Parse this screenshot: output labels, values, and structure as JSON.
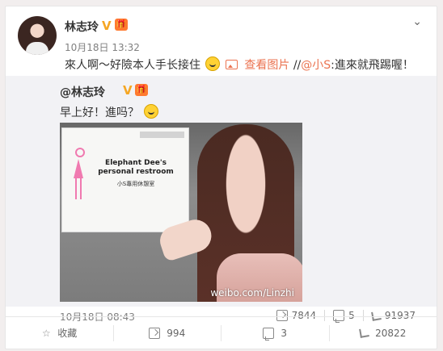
{
  "post": {
    "username": "林志玲",
    "v_badge": "V",
    "badge_icon": "🎁",
    "timestamp": "10月18日 13:32",
    "text_before": "來人啊～好險本人手长接住",
    "view_image_label": "查看图片",
    "separator": " //",
    "mention": "@小S",
    "text_after": ":進來就飛踢喔！"
  },
  "repost": {
    "username": "@林志玲",
    "v_badge": "V",
    "badge_icon": "🎁",
    "text": "早上好！進吗？",
    "photo": {
      "sign_line1": "Elephant Dee's",
      "sign_line2": "personal restroom",
      "sign_line3": "小S專用休憩室",
      "watermark": "weibo.com/Linzhi"
    },
    "timestamp": "10月18日 08:43",
    "actions": {
      "share_count": "7844",
      "comment_count": "5",
      "like_count": "91937"
    }
  },
  "bottom_bar": {
    "favorite_label": "收藏",
    "share_count": "994",
    "comment_count": "3",
    "like_count": "20822"
  },
  "icons": {
    "menu": "chevron-down-icon",
    "emoji": "grin-emoji-icon"
  },
  "colors": {
    "accent": "#eb7350",
    "vip": "#f5a623"
  }
}
